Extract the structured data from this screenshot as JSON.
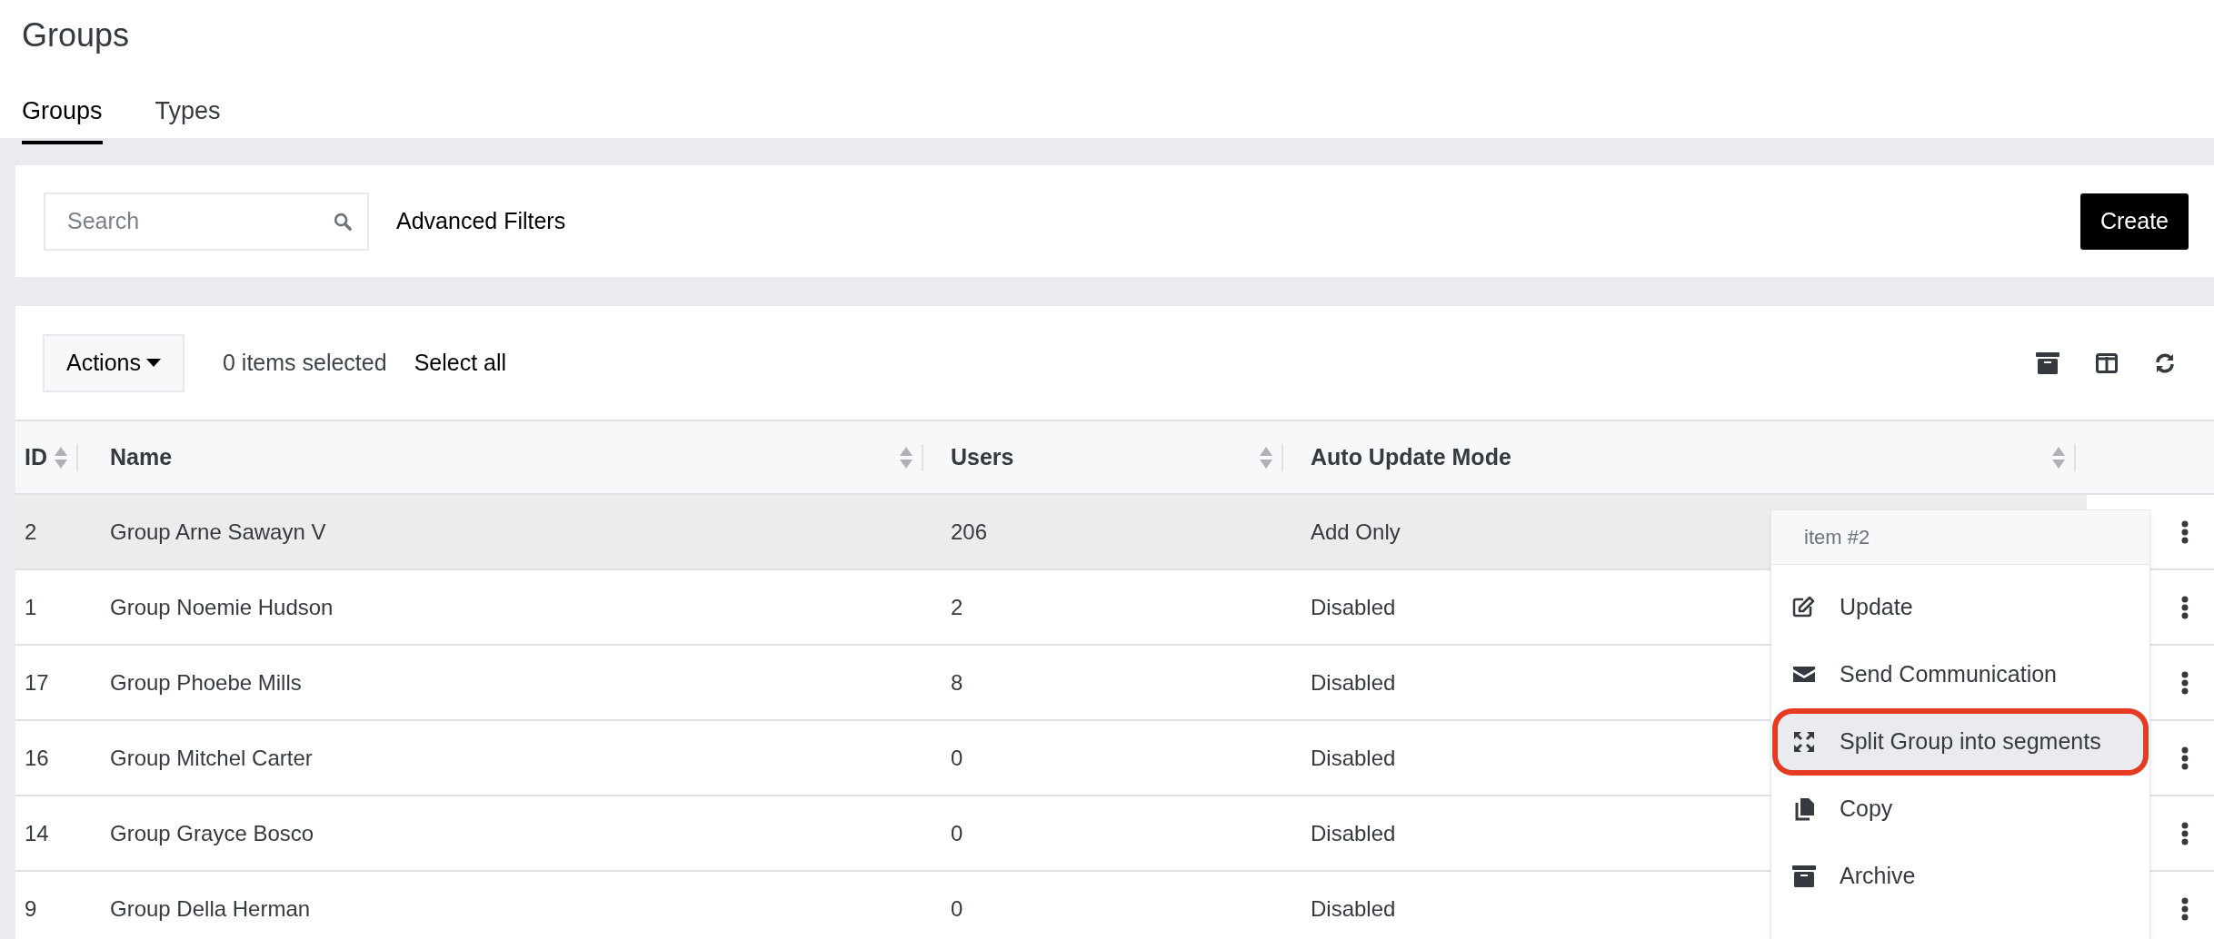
{
  "page_title": "Groups",
  "tabs": [
    {
      "label": "Groups",
      "selected": true
    },
    {
      "label": "Types",
      "selected": false
    }
  ],
  "search": {
    "placeholder": "Search"
  },
  "advanced_filters": "Advanced Filters",
  "create_button": "Create",
  "toolbar": {
    "actions_button": "Actions",
    "selection_count": "0 items selected",
    "select_all": "Select all"
  },
  "table": {
    "columns": [
      {
        "label": "ID"
      },
      {
        "label": "Name"
      },
      {
        "label": "Users"
      },
      {
        "label": "Auto Update Mode"
      }
    ],
    "rows": [
      {
        "id": "2",
        "name": "Group Arne Sawayn V",
        "users": "206",
        "auto_update_mode": "Add Only",
        "selected": true
      },
      {
        "id": "1",
        "name": "Group Noemie Hudson",
        "users": "2",
        "auto_update_mode": "Disabled",
        "selected": false
      },
      {
        "id": "17",
        "name": "Group Phoebe Mills",
        "users": "8",
        "auto_update_mode": "Disabled",
        "selected": false
      },
      {
        "id": "16",
        "name": "Group Mitchel Carter",
        "users": "0",
        "auto_update_mode": "Disabled",
        "selected": false
      },
      {
        "id": "14",
        "name": "Group Grayce Bosco",
        "users": "0",
        "auto_update_mode": "Disabled",
        "selected": false
      },
      {
        "id": "9",
        "name": "Group Della Herman",
        "users": "0",
        "auto_update_mode": "Disabled",
        "selected": false
      }
    ]
  },
  "row_menu": {
    "header": "item #2",
    "items": [
      {
        "label": "Update",
        "kind": "edit",
        "highlighted": false
      },
      {
        "label": "Send Communication",
        "kind": "mail",
        "highlighted": false
      },
      {
        "label": "Split Group into segments",
        "kind": "split",
        "highlighted": true
      },
      {
        "label": "Copy",
        "kind": "copy",
        "highlighted": false
      },
      {
        "label": "Archive",
        "kind": "archive",
        "highlighted": false
      }
    ]
  }
}
